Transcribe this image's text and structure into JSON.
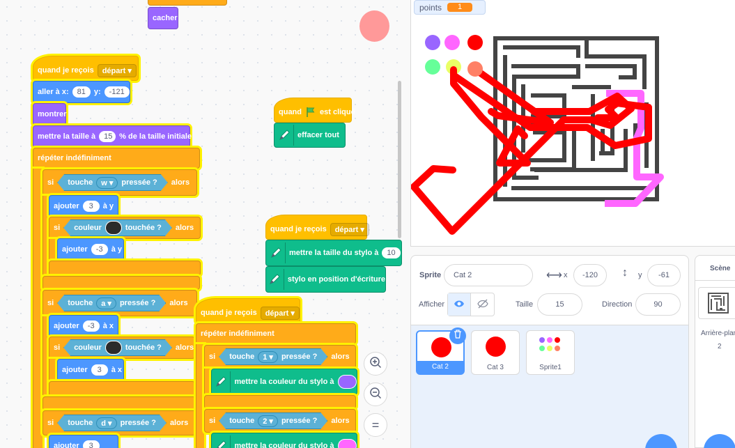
{
  "blocks": {
    "cacher": "cacher",
    "quand_je_recois_1": "quand je reçois",
    "depart_1": "départ",
    "aller_a_x": "aller à x:",
    "x_val": "81",
    "y_label": "y:",
    "y_val": "-121",
    "montrer": "montrer",
    "mettre_taille": "mettre la taille à",
    "taille_val": "15",
    "taille_suffix": "% de la taille initiale",
    "repeter": "répéter indéfiniment",
    "si": "si",
    "alors": "alors",
    "touche": "touche",
    "pressee": "pressée ?",
    "key_w": "w",
    "key_a": "a",
    "key_d": "d",
    "ajouter": "ajouter",
    "val_3": "3",
    "val_neg3": "-3",
    "a_y": "à y",
    "a_x": "à x",
    "couleur": "couleur",
    "touchee": "touchée ?",
    "quand": "quand",
    "est_clique": "est cliqué",
    "effacer_tout": "effacer tout",
    "quand_je_recois_2": "quand je reçois",
    "depart_2": "départ",
    "mettre_taille_stylo": "mettre la taille du stylo à",
    "stylo_taille_val": "10",
    "stylo_position": "stylo en position d'écriture",
    "quand_je_recois_3": "quand je reçois",
    "depart_3": "départ",
    "repeter_2": "répéter indéfiniment",
    "key_1": "1",
    "key_2": "2",
    "mettre_couleur_stylo": "mettre la couleur du stylo à"
  },
  "zoom": {
    "in": "+",
    "out": "−",
    "reset": "="
  },
  "monitor": {
    "label": "points",
    "value": "1"
  },
  "sprite_info": {
    "sprite_label": "Sprite",
    "sprite_name": "Cat 2",
    "x_label": "x",
    "x_value": "-120",
    "y_label": "y",
    "y_value": "-61",
    "afficher_label": "Afficher",
    "taille_label": "Taille",
    "taille_value": "15",
    "direction_label": "Direction",
    "direction_value": "90"
  },
  "sprites": [
    {
      "name": "Cat 2",
      "selected": true
    },
    {
      "name": "Cat 3",
      "selected": false
    },
    {
      "name": "Sprite1",
      "selected": false
    }
  ],
  "stage_selector": {
    "title": "Scène",
    "backdrops_label": "Arrière-plans",
    "backdrops_count": "2"
  },
  "colors": {
    "events": "#ffbf00",
    "motion": "#4c97ff",
    "looks": "#9966ff",
    "control": "#ffab19",
    "sensing": "#5cb1d6",
    "pen": "#0fbd8c",
    "stylo_purple": "#9966ff",
    "stylo_pink": "#ff66ff",
    "touch_color": "#2b2b2b",
    "trail_red": "#ff0000",
    "trail_pink": "#ff66ff"
  }
}
